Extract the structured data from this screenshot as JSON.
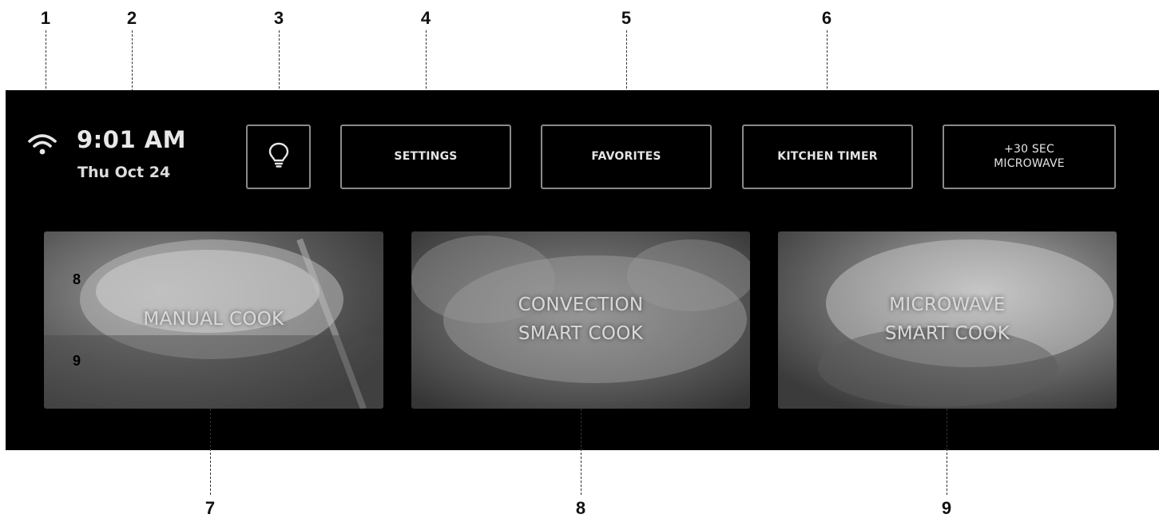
{
  "callouts": [
    "1",
    "2",
    "3",
    "4",
    "5",
    "6",
    "7",
    "8",
    "9"
  ],
  "status": {
    "wifi_icon": "wifi-icon",
    "time": "9:01 AM",
    "date": "Thu Oct 24"
  },
  "toolbar": {
    "light_icon": "lightbulb-icon",
    "settings_label": "SETTINGS",
    "favorites_label": "FAVORITES",
    "kitchen_timer_label": "KITCHEN TIMER",
    "microwave_label": "+30 SEC\nMICROWAVE"
  },
  "tiles": [
    {
      "label": "MANUAL COOK"
    },
    {
      "label": "CONVECTION\nSMART COOK"
    },
    {
      "label": "MICROWAVE\nSMART COOK"
    }
  ],
  "inset_numbers": [
    "8",
    "9"
  ],
  "colors": {
    "panel_bg": "#000000",
    "button_border": "#8a8a8a",
    "text": "#e4e4e4"
  }
}
